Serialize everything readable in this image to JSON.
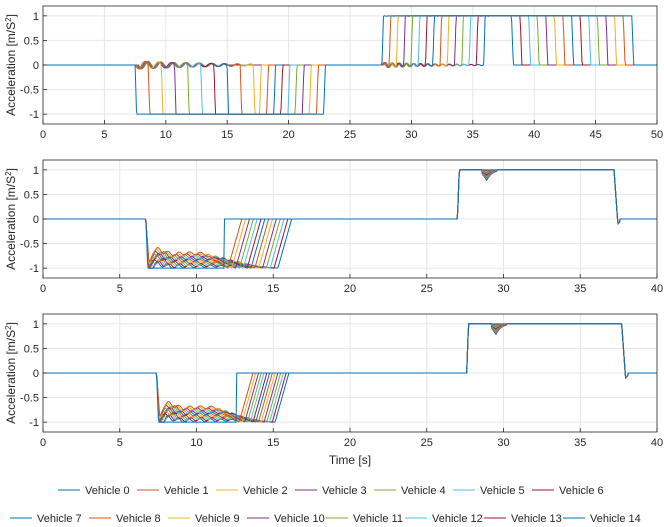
{
  "chart_data": [
    {
      "type": "line",
      "ylabel": "Acceleration [m/S",
      "ylabel_sup": "2",
      "ylabel_close": "]",
      "xlabel": "",
      "xlim": [
        0,
        50
      ],
      "ylim": [
        -1.2,
        1.2
      ],
      "xticks": [
        "0",
        "5",
        "10",
        "15",
        "20",
        "25",
        "30",
        "35",
        "40",
        "45",
        "50"
      ],
      "yticks": [
        "-1",
        "-0.5",
        "0",
        "0.5",
        "1"
      ],
      "grid": true,
      "brake_start": 7.5,
      "brake_step": 1.05,
      "brake_end_first": 23.0,
      "brake_end_step": 0.58,
      "accel_start": 27.6,
      "accel_step": 0.58,
      "accel_end_first": 48.1,
      "accel_end_step": 0.7
    },
    {
      "type": "line",
      "ylabel": "Acceleration [m/S",
      "ylabel_sup": "2",
      "ylabel_close": "]",
      "xlabel": "",
      "xlim": [
        0,
        40
      ],
      "ylim": [
        -1.2,
        1.2
      ],
      "xticks": [
        "0",
        "5",
        "10",
        "15",
        "20",
        "25",
        "30",
        "35",
        "40"
      ],
      "yticks": [
        "-1",
        "-0.5",
        "0",
        "0.5",
        "1"
      ],
      "grid": true,
      "brake_start": 6.7,
      "brake_end_first": 11.8,
      "brake_end_step": 0.25,
      "accel_start": 27.0,
      "accel_end": 37.2
    },
    {
      "type": "line",
      "ylabel": "Acceleration [m/S",
      "ylabel_sup": "2",
      "ylabel_close": "]",
      "xlabel": "Time [s]",
      "xlim": [
        0,
        40
      ],
      "ylim": [
        -1.2,
        1.2
      ],
      "xticks": [
        "0",
        "5",
        "10",
        "15",
        "20",
        "25",
        "30",
        "35",
        "40"
      ],
      "yticks": [
        "-1",
        "-0.5",
        "0",
        "0.5",
        "1"
      ],
      "grid": true,
      "brake_start": 7.4,
      "brake_end_first": 12.6,
      "brake_end_step": 0.18,
      "accel_start": 27.6,
      "accel_end": 37.7
    }
  ],
  "legend": {
    "placement": "bottom",
    "entries": [
      "Vehicle 0",
      "Vehicle 1",
      "Vehicle 2",
      "Vehicle 3",
      "Vehicle 4",
      "Vehicle 5",
      "Vehicle 6",
      "Vehicle 7",
      "Vehicle 8",
      "Vehicle 9",
      "Vehicle 10",
      "Vehicle 11",
      "Vehicle 12",
      "Vehicle 13",
      "Vehicle 14"
    ]
  },
  "colors": [
    "#0072BD",
    "#D95319",
    "#EDB120",
    "#7E2F8E",
    "#77AC30",
    "#4DBEEE",
    "#A2142F",
    "#0072BD",
    "#D95319",
    "#EDB120",
    "#7E2F8E",
    "#77AC30",
    "#4DBEEE",
    "#A2142F",
    "#0072BD"
  ]
}
